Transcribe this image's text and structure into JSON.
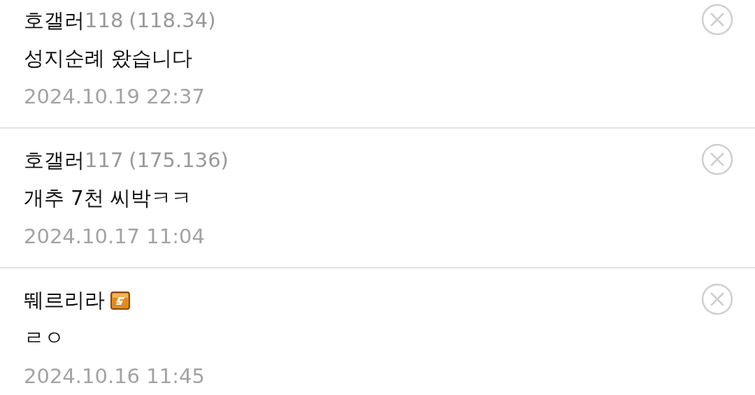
{
  "comments": [
    {
      "author": "호갤러",
      "suffix": "118",
      "ip": "(118.34)",
      "badge": false,
      "text": "성지순례 왔습니다",
      "date": "2024.10.19 22:37"
    },
    {
      "author": "호갤러",
      "suffix": "117",
      "ip": "(175.136)",
      "badge": false,
      "text": "개추 7천 씨박ㅋㅋ",
      "date": "2024.10.17 11:04"
    },
    {
      "author": "뛔르리라",
      "badge": true,
      "text": "ㄹㅇ",
      "date": "2024.10.16 11:45"
    }
  ]
}
